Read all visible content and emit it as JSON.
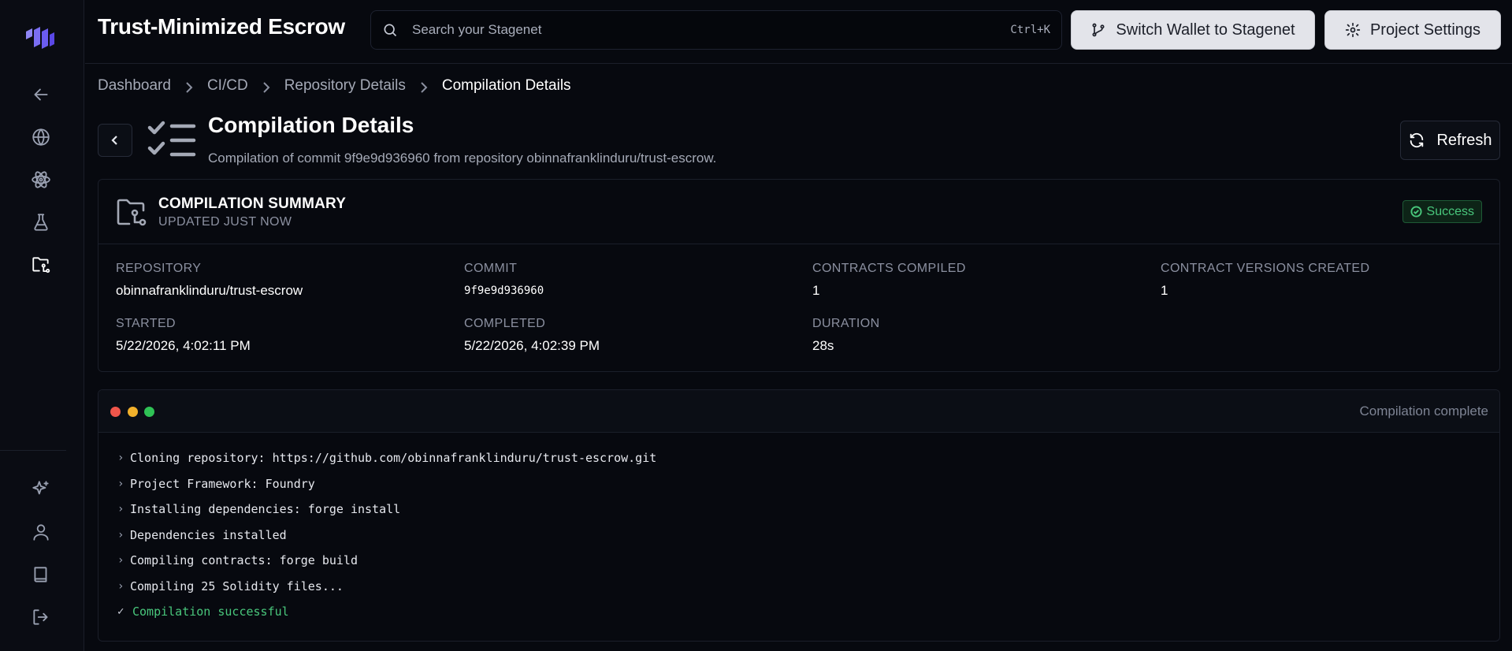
{
  "header": {
    "project_title": "Trust-Minimized Escrow",
    "search_placeholder": "Search your Stagenet",
    "search_shortcut": "Ctrl+K",
    "switch_wallet_label": "Switch Wallet to Stagenet",
    "project_settings_label": "Project Settings"
  },
  "sidebar": {
    "items": [
      {
        "icon": "arrow-left-icon"
      },
      {
        "icon": "globe-icon"
      },
      {
        "icon": "atom-icon"
      },
      {
        "icon": "flask-icon"
      },
      {
        "icon": "folder-git-icon",
        "active": true
      },
      {
        "icon": "sparkles-icon"
      },
      {
        "icon": "user-icon"
      },
      {
        "icon": "book-icon"
      },
      {
        "icon": "logout-icon"
      }
    ]
  },
  "breadcrumb": [
    "Dashboard",
    "CI/CD",
    "Repository Details",
    "Compilation Details"
  ],
  "page": {
    "title": "Compilation Details",
    "subtitle": "Compilation of commit 9f9e9d936960 from repository obinnafranklinduru/trust-escrow.",
    "refresh_label": "Refresh"
  },
  "summary": {
    "title": "COMPILATION SUMMARY",
    "updated": "UPDATED JUST NOW",
    "status": "Success",
    "fields": {
      "repository": {
        "label": "REPOSITORY",
        "value": "obinnafranklinduru/trust-escrow"
      },
      "commit": {
        "label": "COMMIT",
        "value": "9f9e9d936960"
      },
      "contracts_compiled": {
        "label": "CONTRACTS COMPILED",
        "value": "1"
      },
      "contract_versions": {
        "label": "CONTRACT VERSIONS CREATED",
        "value": "1"
      },
      "started": {
        "label": "STARTED",
        "value": "5/22/2026, 4:02:11 PM"
      },
      "completed": {
        "label": "COMPLETED",
        "value": "5/22/2026, 4:02:39 PM"
      },
      "duration": {
        "label": "DURATION",
        "value": "28s"
      }
    }
  },
  "terminal": {
    "status": "Compilation complete",
    "lines": [
      {
        "marker": "›",
        "text": "Cloning repository: https://github.com/obinnafranklinduru/trust-escrow.git"
      },
      {
        "marker": "›",
        "text": "Project Framework: Foundry"
      },
      {
        "marker": "›",
        "text": "Installing dependencies: forge install"
      },
      {
        "marker": "›",
        "text": "Dependencies installed"
      },
      {
        "marker": "›",
        "text": "Compiling contracts: forge build"
      },
      {
        "marker": "›",
        "text": "Compiling 25 Solidity files..."
      },
      {
        "marker": "✓",
        "text": "Compilation successful"
      }
    ]
  },
  "colors": {
    "background": "#07090f",
    "accent": "#6b5cf0",
    "success": "#49c77c",
    "muted_text": "#8b90a0"
  }
}
